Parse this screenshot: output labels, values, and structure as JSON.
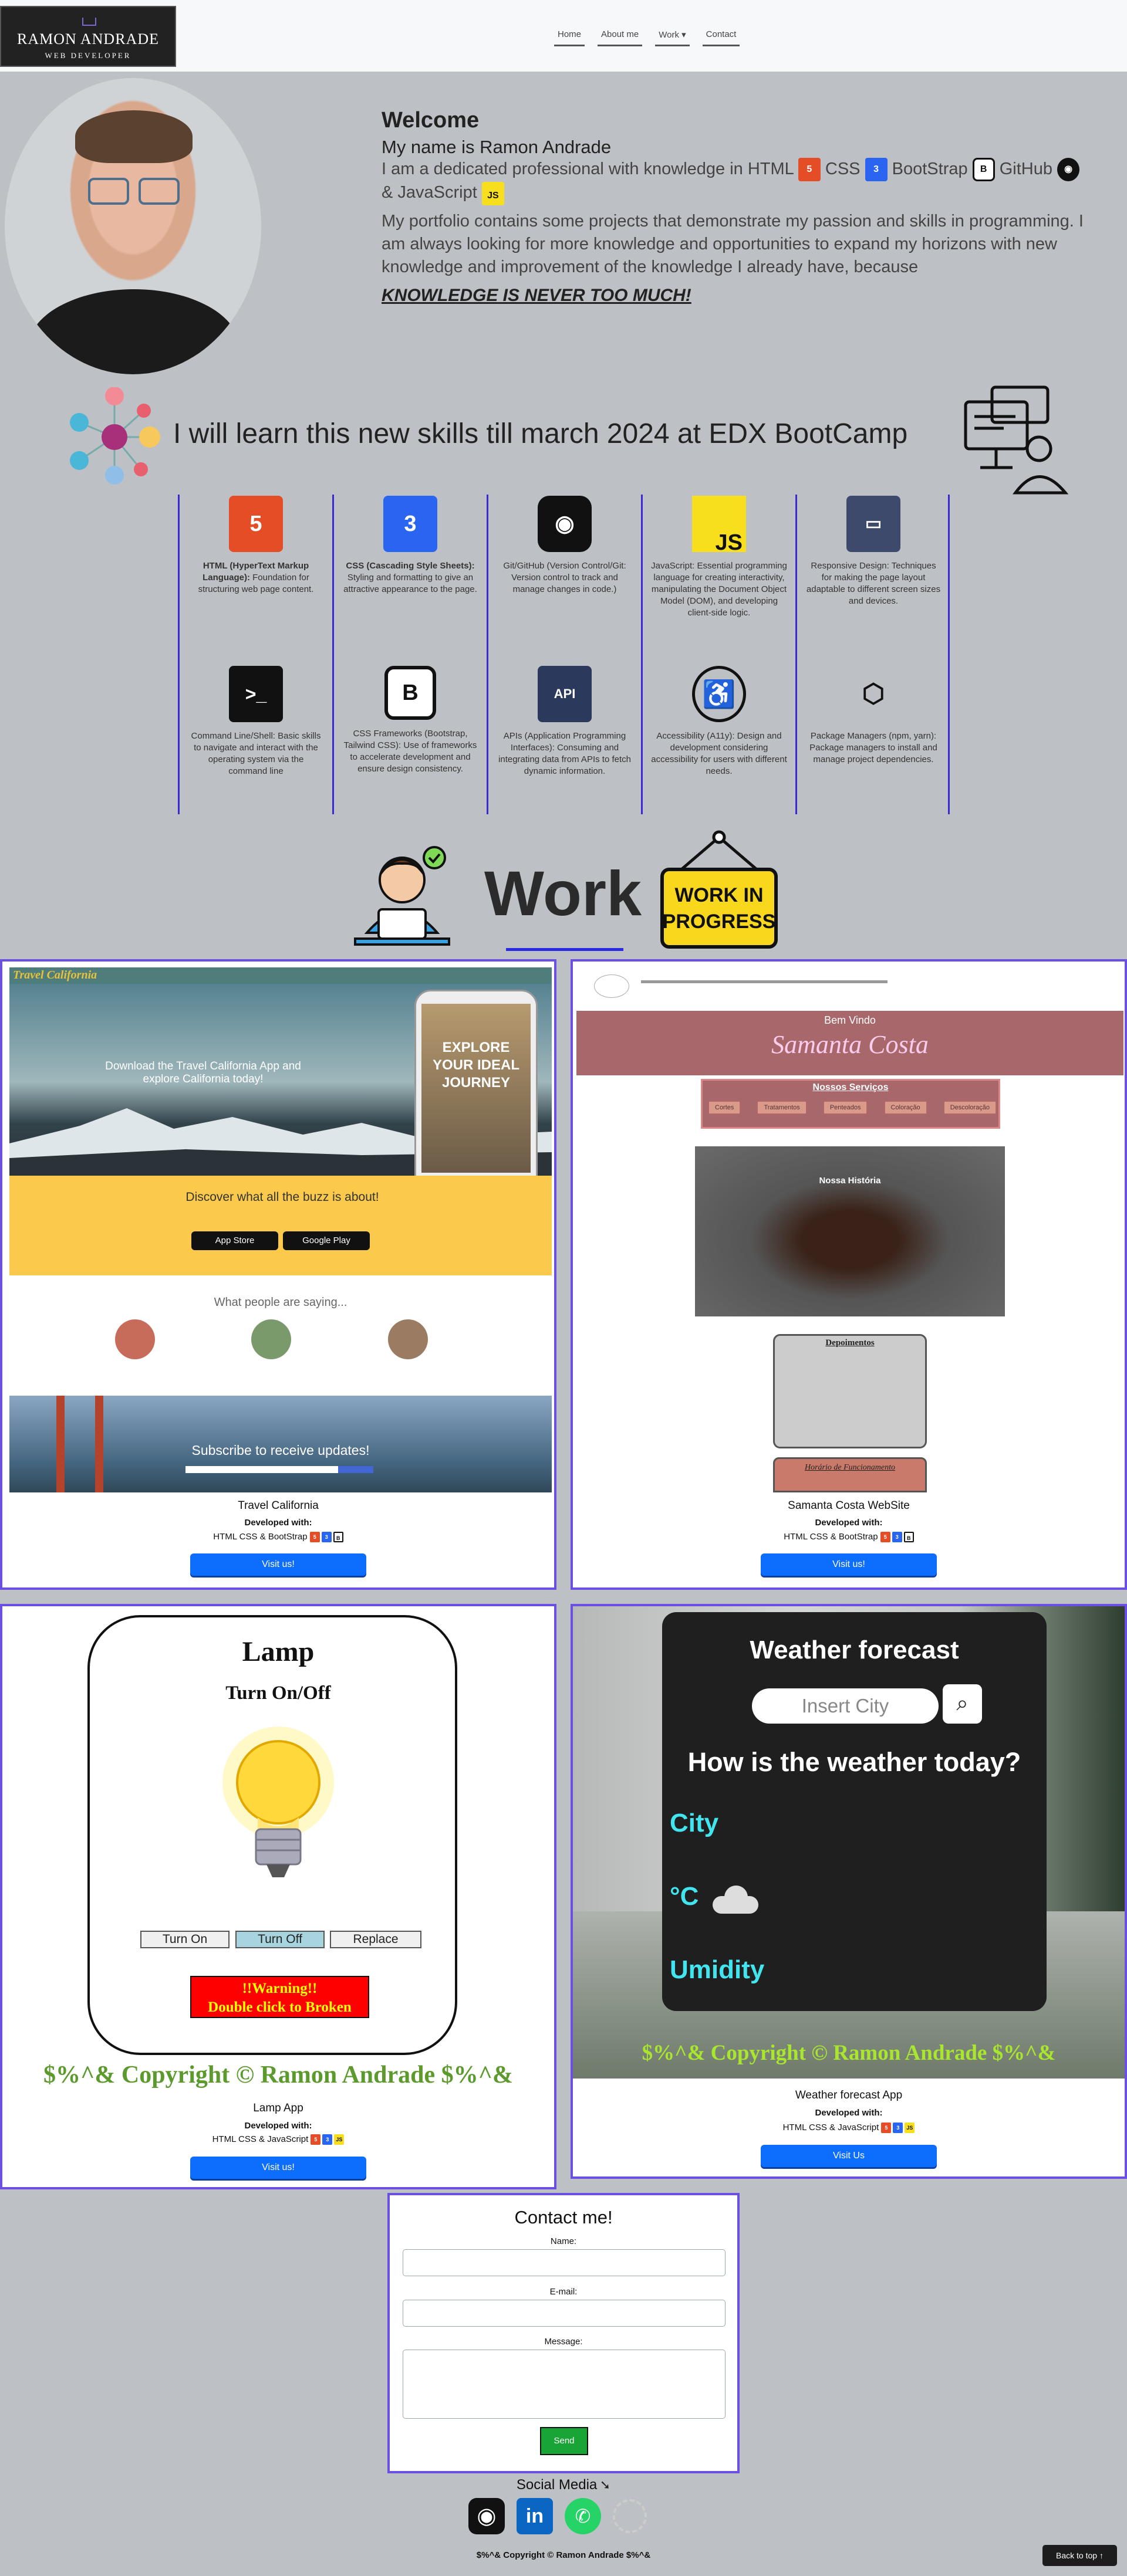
{
  "nav": {
    "logo_line1": "RAMON ANDRADE",
    "logo_line2": "WEB DEVELOPER",
    "links": [
      "Home",
      "About me",
      "Work ▾",
      "Contact"
    ]
  },
  "hero": {
    "welcome": "Welcome",
    "name": "My name is Ramon Andrade",
    "intro": "I am a dedicated professional with knowledge in HTML",
    "css": "CSS",
    "bootstrap": "BootStrap",
    "github": "GitHub",
    "and_js": "& JavaScript",
    "tech_icons": [
      "html5-icon",
      "css3-icon",
      "bootstrap-icon",
      "github-icon",
      "javascript-icon"
    ],
    "paragraph": "My portfolio contains some projects that demonstrate my passion and skills in programming. I am always looking for more knowledge and opportunities to expand my horizons with new knowledge and improvement of the knowledge I already have, because",
    "motto": "KNOWLEDGE IS NEVER TOO MUCH!"
  },
  "learn": {
    "heading": "I will learn this new skills till march 2024 at EDX BootCamp"
  },
  "skills": [
    {
      "icon": "html5-icon",
      "title": "HTML (HyperText Markup Language):",
      "desc": " Foundation for structuring web page content."
    },
    {
      "icon": "css3-icon",
      "title": "CSS (Cascading Style Sheets):",
      "desc": " Styling and formatting to give an attractive appearance to the page."
    },
    {
      "icon": "github-icon",
      "title": "",
      "desc": "Git/GitHub (Version Control/Git: Version control to track and manage changes in code.)"
    },
    {
      "icon": "javascript-icon",
      "title": "",
      "desc": "JavaScript: Essential programming language for creating interactivity, manipulating the Document Object Model (DOM), and developing client-side logic."
    },
    {
      "icon": "responsive-icon",
      "title": "",
      "desc": "Responsive Design: Techniques for making the page layout adaptable to different screen sizes and devices."
    },
    {
      "icon": "terminal-icon",
      "title": "",
      "desc": "Command Line/Shell: Basic skills to navigate and interact with the operating system via the command line"
    },
    {
      "icon": "bootstrap-icon",
      "title": "",
      "desc": "CSS Frameworks (Bootstrap, Tailwind CSS): Use of frameworks to accelerate development and ensure design consistency."
    },
    {
      "icon": "api-icon",
      "title": "",
      "desc": "APIs (Application Programming Interfaces): Consuming and integrating data from APIs to fetch dynamic information."
    },
    {
      "icon": "accessibility-icon",
      "title": "",
      "desc": "Accessibility (A11y): Design and development considering accessibility for users with different needs."
    },
    {
      "icon": "package-icon",
      "title": "",
      "desc": "Package Managers (npm, yarn): Package managers to install and manage project dependencies."
    }
  ],
  "work": {
    "heading": "Work",
    "wip_line1": "WORK IN",
    "wip_line2": "PROGRESS"
  },
  "projects": [
    {
      "title": "Travel California",
      "dev": "Developed with:",
      "stack": "HTML CSS & BootStrap",
      "btn": "Visit us!",
      "shot": {
        "logo": "Travel California",
        "hero_line1": "Download the Travel California App and",
        "hero_line2": "explore California today!",
        "phone_text": "EXPLORE YOUR IDEAL JOURNEY",
        "buzz": "Discover what all the buzz is about!",
        "app_store": "App Store",
        "google_play": "Google Play",
        "saying": "What people are saying...",
        "subscribe": "Subscribe to receive updates!"
      }
    },
    {
      "title": "Samanta Costa WebSite",
      "dev": "Developed with:",
      "stack": "HTML CSS & BootStrap",
      "btn": "Visit us!",
      "shot": {
        "welcome": "Bem Vindo",
        "name": "Samanta Costa",
        "services": "Nossos Serviços",
        "chips": [
          "Cortes",
          "Tratamentos",
          "Penteados",
          "Coloração",
          "Descoloração"
        ],
        "history": "Nossa História",
        "testimonials": "Depoimentos",
        "hours": "Horário de Funcionamento"
      }
    },
    {
      "title": "Lamp App",
      "dev": "Developed with:",
      "stack": "HTML CSS & JavaScript",
      "btn": "Visit us!",
      "shot": {
        "heading": "Lamp",
        "sub": "Turn On/Off",
        "on": "Turn On",
        "off": "Turn Off",
        "replace": "Replace",
        "warn1": "!!Warning!!",
        "warn2": "Double click to Broken",
        "copyright": "$%^& Copyright © Ramon Andrade $%^&"
      }
    },
    {
      "title": "Weather forecast App",
      "dev": "Developed with:",
      "stack": "HTML CSS & JavaScript",
      "btn": "Visit Us",
      "shot": {
        "heading": "Weather forecast",
        "placeholder": "Insert City",
        "question": "How is the weather today?",
        "city": "City",
        "temp": "°C",
        "humidity": "Umidity",
        "copyright": "$%^& Copyright © Ramon Andrade $%^&"
      }
    }
  ],
  "contact": {
    "heading": "Contact me!",
    "name_label": "Name:",
    "email_label": "E-mail:",
    "message_label": "Message:",
    "send": "Send"
  },
  "social": {
    "heading": "Social Media",
    "icons": [
      "github-icon",
      "linkedin-icon",
      "whatsapp-icon",
      "loading-icon"
    ]
  },
  "footer": {
    "copyright": "$%^& Copyright © Ramon Andrade $%^&",
    "back_to_top": "Back to top ↑"
  }
}
